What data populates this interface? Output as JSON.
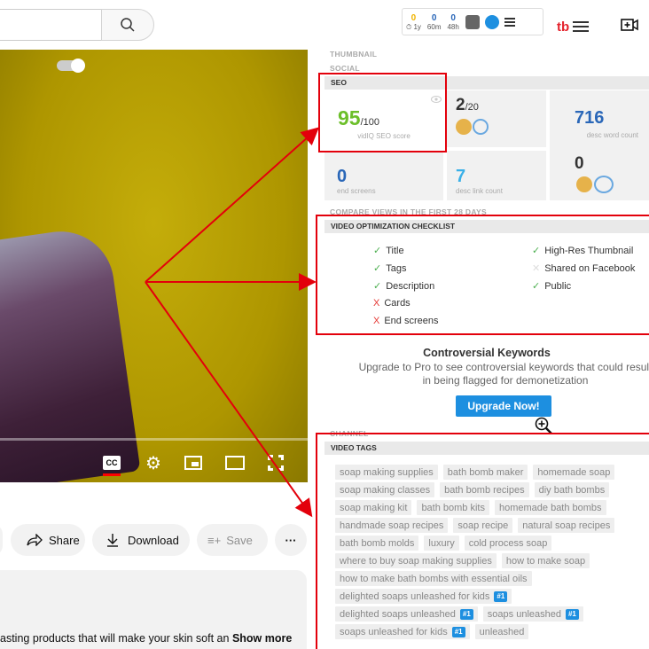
{
  "header": {
    "search_icon": "search-icon",
    "stats": [
      {
        "value": "0",
        "label": "⏱ 1y",
        "color": "#f0b400"
      },
      {
        "value": "0",
        "label": "60m",
        "color": "#2a67b8"
      },
      {
        "value": "0",
        "label": "48h",
        "color": "#2a67b8"
      }
    ],
    "tb_logo": "tb"
  },
  "player": {
    "cc_label": "CC"
  },
  "actions": {
    "share": "Share",
    "download": "Download",
    "save": "Save",
    "more": "···"
  },
  "description": {
    "text": "asting products that will make your skin soft an",
    "show_more": "Show more"
  },
  "panel": {
    "labels": {
      "thumbnail": "THUMBNAIL",
      "social": "SOCIAL",
      "compare": "COMPARE VIEWS IN THE FIRST 28 DAYS",
      "channel": "CHANNEL"
    },
    "seo": {
      "heading": "SEO",
      "score": "95",
      "score_max": "/100",
      "score_label": "vidIQ SEO score",
      "tags_count": "2",
      "tags_max": "/20",
      "desc_words": "716",
      "desc_words_label": "desc word count",
      "end_screens": "0",
      "end_screens_label": "end screens",
      "desc_links": "7",
      "desc_links_label": "desc link count",
      "subs_value": "0"
    },
    "checklist": {
      "heading": "VIDEO OPTIMIZATION CHECKLIST",
      "items_left": [
        {
          "label": "Title",
          "status": "ok",
          "mark": "✓"
        },
        {
          "label": "Tags",
          "status": "ok",
          "mark": "✓"
        },
        {
          "label": "Description",
          "status": "ok",
          "mark": "✓"
        },
        {
          "label": "Cards",
          "status": "bad",
          "mark": "X"
        },
        {
          "label": "End screens",
          "status": "bad",
          "mark": "X"
        }
      ],
      "items_right": [
        {
          "label": "High-Res Thumbnail",
          "status": "ok",
          "mark": "✓"
        },
        {
          "label": "Shared on Facebook",
          "status": "grey",
          "mark": "✕"
        },
        {
          "label": "Public",
          "status": "ok",
          "mark": "✓"
        }
      ]
    },
    "controversial": {
      "title": "Controversial Keywords",
      "subtitle": "Upgrade to Pro to see controversial keywords that could result in being flagged for demonetization",
      "button": "Upgrade Now!"
    },
    "tags": {
      "heading": "VIDEO TAGS",
      "items": [
        {
          "text": "soap making supplies"
        },
        {
          "text": "bath bomb maker"
        },
        {
          "text": "homemade soap"
        },
        {
          "text": "soap making classes"
        },
        {
          "text": "bath bomb recipes"
        },
        {
          "text": "diy bath bombs"
        },
        {
          "text": "soap making kit"
        },
        {
          "text": "bath bomb kits"
        },
        {
          "text": "homemade bath bombs"
        },
        {
          "text": "handmade soap recipes"
        },
        {
          "text": "soap recipe"
        },
        {
          "text": "natural soap recipes"
        },
        {
          "text": "bath bomb molds"
        },
        {
          "text": "luxury"
        },
        {
          "text": "cold process soap"
        },
        {
          "text": "where to buy soap making supplies"
        },
        {
          "text": "how to make soap"
        },
        {
          "text": "how to make bath bombs with essential oils"
        },
        {
          "text": "delighted soaps unleashed for kids",
          "rank": "#1"
        },
        {
          "text": "delighted soaps unleashed",
          "rank": "#1"
        },
        {
          "text": "soaps unleashed",
          "rank": "#1"
        },
        {
          "text": "soaps unleashed for kids",
          "rank": "#1"
        },
        {
          "text": "unleashed"
        }
      ]
    }
  }
}
